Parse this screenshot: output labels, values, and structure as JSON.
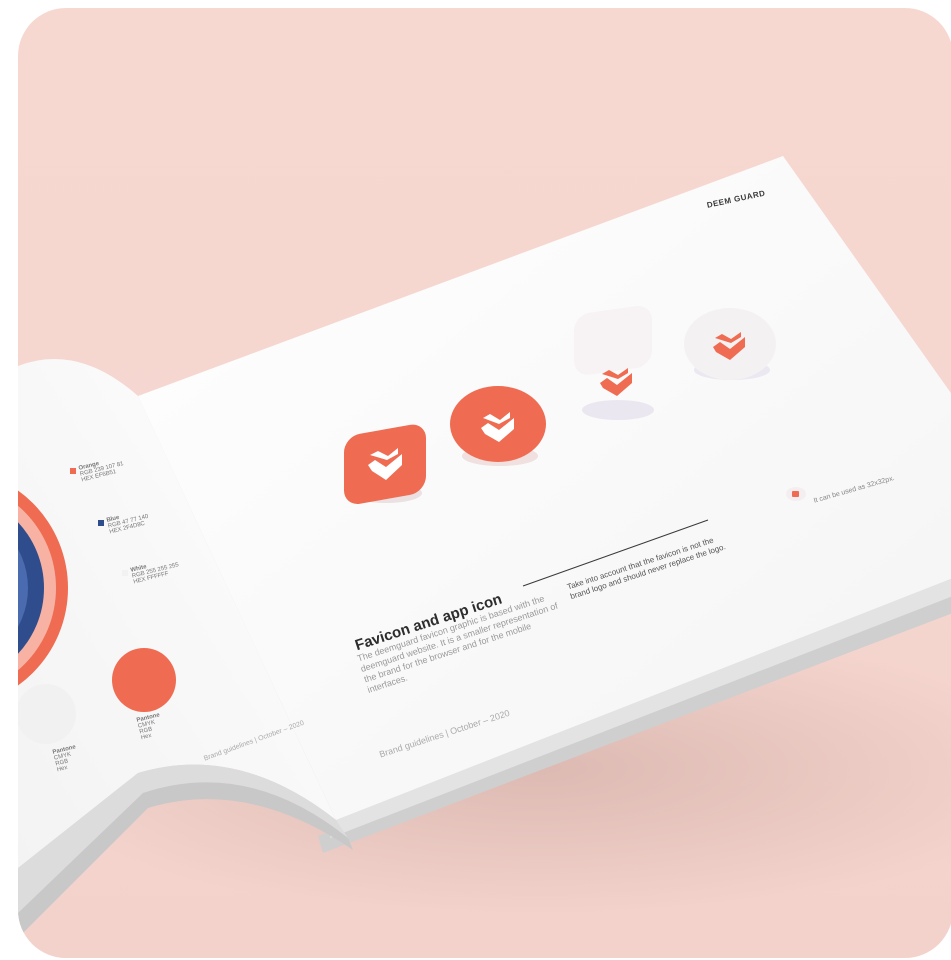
{
  "brand": {
    "name": "DEEM GUARD",
    "accent": "#ef6b51",
    "blue": "#2f4d8c"
  },
  "page": {
    "section_title": "Favicon and app icon",
    "section_body": "The deemguard favicon graphic is based with the deemguard website. It is a smaller representation of the brand for the browser and for the mobile interfaces.",
    "note": "Take into account that the favicon is not the brand logo and should never replace the logo.",
    "usage_note": "It can be used as 32x32px.",
    "footer": "Brand guidelines | October – 2020"
  },
  "left_page": {
    "footer": "Brand guidelines | October – 2020",
    "swatches": [
      {
        "title": "Orange",
        "lines": [
          "RGB 239 107 81",
          "HEX EF6B51"
        ]
      },
      {
        "title": "Blue",
        "lines": [
          "RGB 47 77 140",
          "HEX 2F4D8C"
        ]
      },
      {
        "title": "White",
        "lines": [
          "RGB 255 255 255",
          "HEX FFFFFF"
        ]
      },
      {
        "title": "Pantone",
        "lines": [
          "CMYK",
          "RGB",
          "Hex"
        ]
      },
      {
        "title": "Pantone",
        "lines": [
          "CMYK",
          "RGB",
          "Hex"
        ]
      }
    ]
  },
  "icons": [
    {
      "name": "favicon-orange-square",
      "shape": "rounded-square",
      "fill": "#ef6b51",
      "mark": "#ffffff"
    },
    {
      "name": "favicon-orange-circle",
      "shape": "circle",
      "fill": "#ef6b51",
      "mark": "#ffffff"
    },
    {
      "name": "favicon-white-square",
      "shape": "rounded-square",
      "fill": "#f7f3f4",
      "mark": "#ef6b51"
    },
    {
      "name": "favicon-white-circle",
      "shape": "circle",
      "fill": "#f4f1f3",
      "mark": "#ef6b51"
    }
  ]
}
